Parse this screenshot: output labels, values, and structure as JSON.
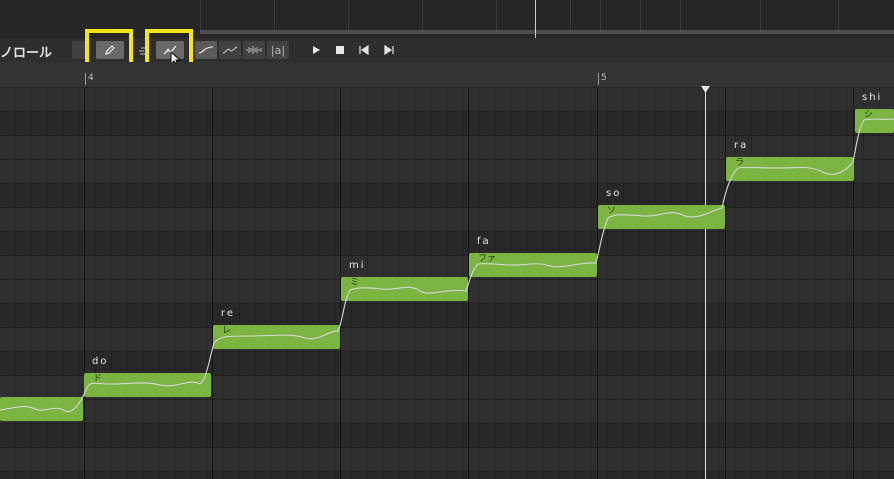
{
  "toolbar": {
    "title": "ノロール",
    "mode_pencil_icon": "pencil-icon",
    "mode_line_icon": "line-draw-icon",
    "curve_icon": "curve-icon",
    "wave_icon": "wave-icon",
    "waveform_icon": "waveform-icon",
    "text_label": "|a|",
    "play_icon": "play-icon",
    "stop_icon": "stop-icon",
    "prev_icon": "skip-back-icon",
    "next_icon": "skip-forward-icon"
  },
  "ruler": {
    "bars": [
      "4",
      "5"
    ]
  },
  "notes": [
    {
      "lyric": "",
      "phoneme": ""
    },
    {
      "lyric": "do",
      "phoneme": "ド"
    },
    {
      "lyric": "re",
      "phoneme": "レ"
    },
    {
      "lyric": "mi",
      "phoneme": "ミ"
    },
    {
      "lyric": "fa",
      "phoneme": "ファ"
    },
    {
      "lyric": "so",
      "phoneme": "ソ"
    },
    {
      "lyric": "ra",
      "phoneme": "ラ"
    },
    {
      "lyric": "shi",
      "phoneme": "シ"
    }
  ],
  "colors": {
    "note": "#7cb442",
    "highlight": "#f5e416",
    "background": "#2b2b2b"
  }
}
